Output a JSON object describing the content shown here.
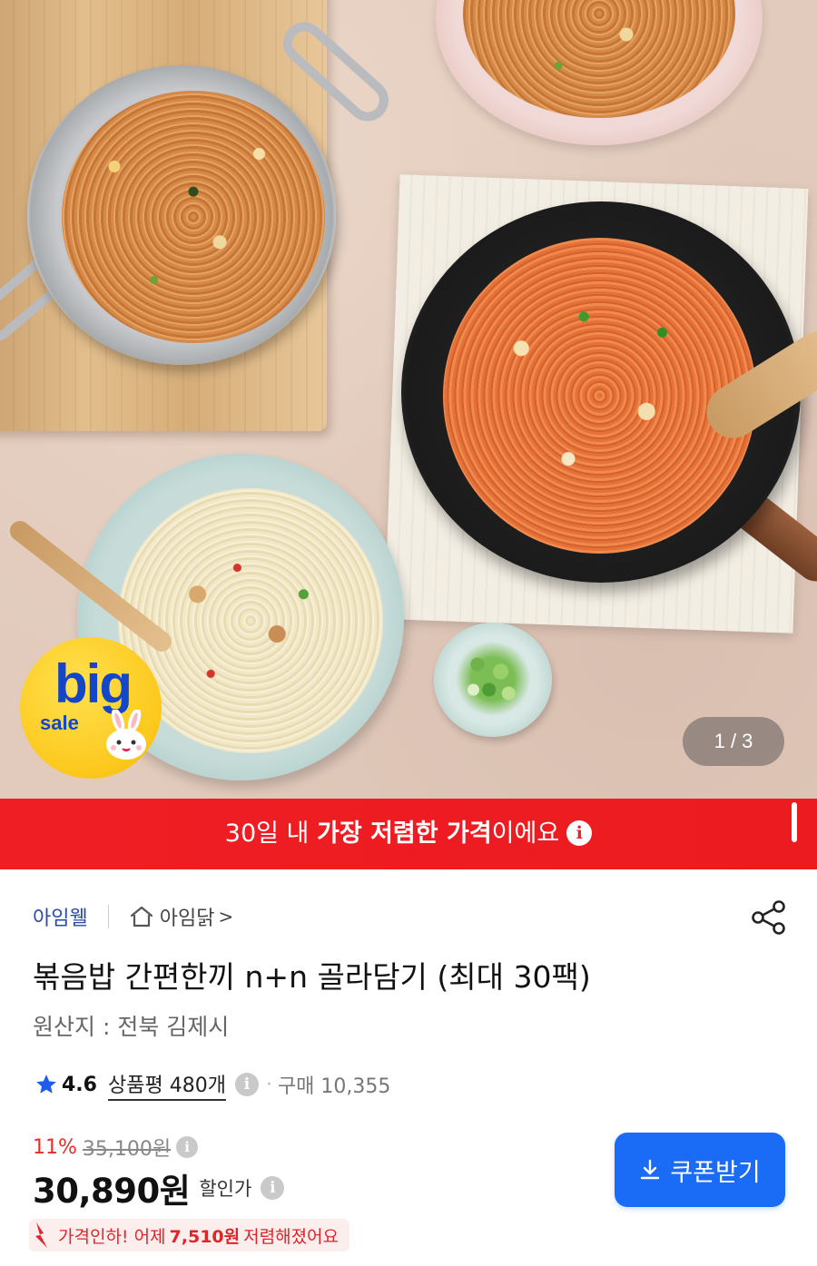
{
  "gallery": {
    "counter": "1 / 3",
    "badge": {
      "big": "big",
      "sale": "sale"
    }
  },
  "banner": {
    "prefix": "30일 내 ",
    "highlight": "가장 저렴한 가격",
    "suffix": "이에요",
    "info_icon": "i"
  },
  "product": {
    "brand": "아임웰",
    "store": "아임닭",
    "store_chevron": ">",
    "title": "볶음밥 간편한끼 n+n 골라담기 (최대 30팩)",
    "origin": "원산지 : 전북 김제시",
    "rating": "4.6",
    "reviews": "상품평 480개",
    "purchases": "구매 10,355",
    "discount_pct": "11%",
    "original_price": "35,100원",
    "price": "30,890원",
    "price_label": "할인가",
    "coupon_button": "쿠폰받기",
    "price_drop": {
      "prefix": "가격인하! 어제",
      "amount": "7,510원",
      "suffix": "저렴해졌어요"
    },
    "info_icon": "i"
  },
  "colors": {
    "banner_red": "#ef1e24",
    "brand_blue": "#2a4aa8",
    "coupon_blue": "#1a6bf5",
    "discount_red": "#ee2a24",
    "badge_yellow": "#fcc81c"
  },
  "icons": [
    "home-icon",
    "share-icon",
    "star-icon",
    "info-icon",
    "download-icon",
    "price-down-icon"
  ]
}
